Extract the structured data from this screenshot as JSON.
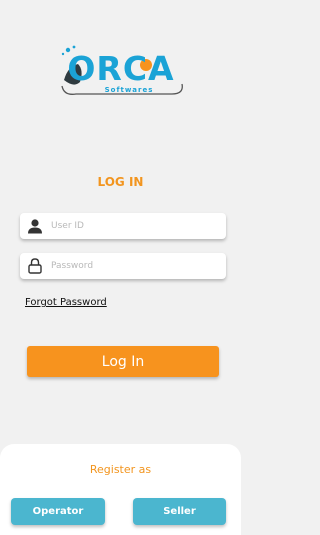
{
  "brand": {
    "name": "ORCA",
    "subtitle": "Softwares",
    "primary_color": "#1ba3d6",
    "accent_color": "#f7931e"
  },
  "login": {
    "heading": "LOG IN",
    "user_id_placeholder": "User ID",
    "password_placeholder": "Password",
    "forgot_password": "Forgot Password",
    "login_button": "Log In"
  },
  "register": {
    "label": "Register as",
    "operator_button": "Operator",
    "seller_button": "Seller",
    "button_color": "#4bb6cf"
  },
  "icons": {
    "user_field": "person-icon",
    "password_field": "lock-icon"
  }
}
